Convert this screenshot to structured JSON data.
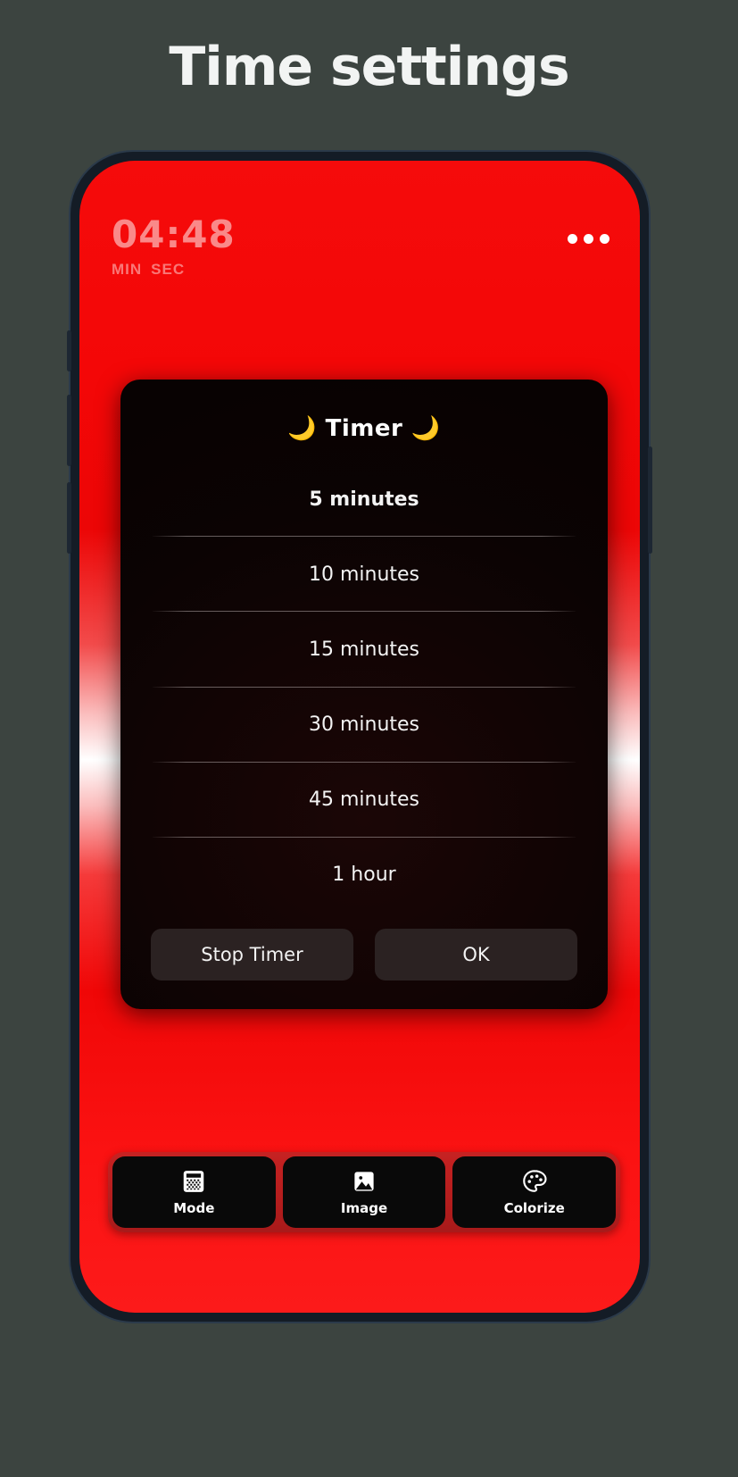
{
  "page": {
    "title": "Time settings",
    "background_color": "#3c4440"
  },
  "phone": {
    "app": {
      "accent_color": "#f50b0b",
      "status": {
        "time_value": "04:48",
        "unit_min": "MIN",
        "unit_sec": "SEC"
      },
      "overflow_menu_icon": "more-horizontal-icon"
    },
    "dialog": {
      "title": "🌙 Timer 🌙",
      "options": [
        {
          "label": "5 minutes",
          "selected": true
        },
        {
          "label": "10 minutes",
          "selected": false
        },
        {
          "label": "15 minutes",
          "selected": false
        },
        {
          "label": "30 minutes",
          "selected": false
        },
        {
          "label": "45 minutes",
          "selected": false
        },
        {
          "label": "1 hour",
          "selected": false
        }
      ],
      "stop_label": "Stop Timer",
      "ok_label": "OK"
    },
    "toolbar": {
      "buttons": [
        {
          "label": "Mode",
          "icon": "grid-dither-icon"
        },
        {
          "label": "Image",
          "icon": "image-picture-icon"
        },
        {
          "label": "Colorize",
          "icon": "palette-icon"
        }
      ]
    }
  }
}
